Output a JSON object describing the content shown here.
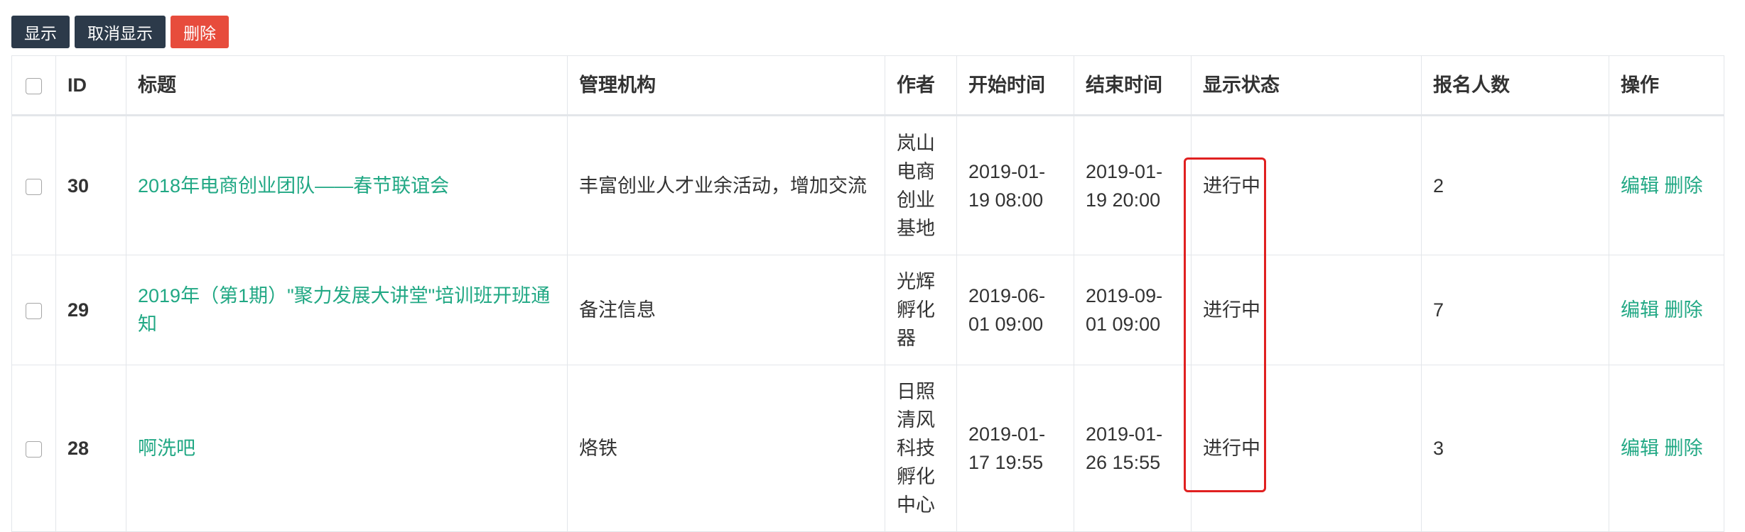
{
  "toolbar": {
    "show_label": "显示",
    "hide_label": "取消显示",
    "delete_label": "删除"
  },
  "table": {
    "headers": {
      "id": "ID",
      "title": "标题",
      "org": "管理机构",
      "author": "作者",
      "start": "开始时间",
      "end": "结束时间",
      "status": "显示状态",
      "count": "报名人数",
      "ops": "操作"
    },
    "rows": [
      {
        "id": "30",
        "title": "2018年电商创业团队——春节联谊会",
        "org": "丰富创业人才业余活动，增加交流",
        "author": "岚山电商创业基地",
        "start": "2019-01-19 08:00",
        "end": "2019-01-19 20:00",
        "status": "进行中",
        "count": "2",
        "edit": "编辑",
        "delete": "删除"
      },
      {
        "id": "29",
        "title": "2019年（第1期）\"聚力发展大讲堂\"培训班开班通知",
        "org": "备注信息",
        "author": "光辉孵化器",
        "start": "2019-06-01 09:00",
        "end": "2019-09-01 09:00",
        "status": "进行中",
        "count": "7",
        "edit": "编辑",
        "delete": "删除"
      },
      {
        "id": "28",
        "title": "啊洗吧",
        "org": "烙铁",
        "author": "日照清风科技孵化中心",
        "start": "2019-01-17 19:55",
        "end": "2019-01-26 15:55",
        "status": "进行中",
        "count": "3",
        "edit": "编辑",
        "delete": "删除"
      }
    ]
  },
  "colors": {
    "accent": "#21a884",
    "dark_button": "#2c3a4a",
    "danger_button": "#e74c3c",
    "highlight": "#e02020"
  }
}
